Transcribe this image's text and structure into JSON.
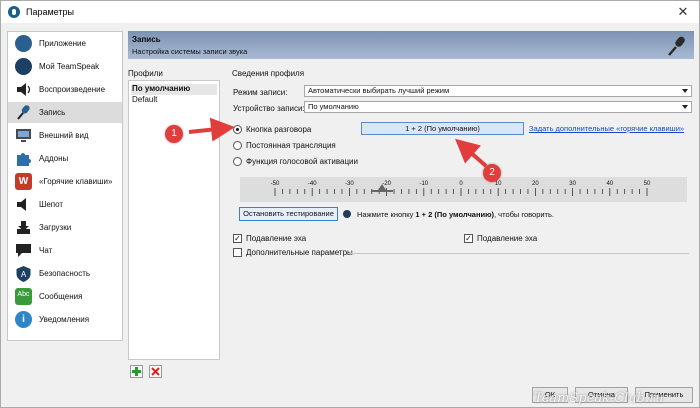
{
  "window": {
    "title": "Параметры"
  },
  "sidebar": {
    "items": [
      {
        "label": "Приложение",
        "icon": "teamspeak-app-icon",
        "color": "#2b5f8f"
      },
      {
        "label": "Мой TeamSpeak",
        "icon": "teamspeak-user-icon",
        "color": "#1d3f63"
      },
      {
        "label": "Воспроизведение",
        "icon": "speaker-icon",
        "color": "#222222"
      },
      {
        "label": "Запись",
        "icon": "microphone-icon",
        "color": "#2b5f8f"
      },
      {
        "label": "Внешний вид",
        "icon": "monitor-icon",
        "color": "#4a4a4a"
      },
      {
        "label": "Аддоны",
        "icon": "puzzle-icon",
        "color": "#2f6ea8"
      },
      {
        "label": "«Горячие клавиши»",
        "icon": "hotkeys-icon",
        "color": "#c43a2b"
      },
      {
        "label": "Шепот",
        "icon": "whisper-icon",
        "color": "#222222"
      },
      {
        "label": "Загрузки",
        "icon": "download-icon",
        "color": "#222222"
      },
      {
        "label": "Чат",
        "icon": "chat-icon",
        "color": "#222222"
      },
      {
        "label": "Безопасность",
        "icon": "shield-icon",
        "color": "#1d3f63"
      },
      {
        "label": "Сообщения",
        "icon": "abc-spellcheck-icon",
        "color": "#3a9a3a"
      },
      {
        "label": "Уведомления",
        "icon": "info-icon",
        "color": "#2e86c9"
      }
    ],
    "selected_index": 3
  },
  "header": {
    "title": "Запись",
    "subtitle": "Настройка системы записи звука"
  },
  "profiles": {
    "label": "Профили",
    "items": [
      "По умолчанию",
      "Default"
    ],
    "selected_index": 0
  },
  "details": {
    "label": "Сведения профиля",
    "mode_label": "Режим записи:",
    "mode_value": "Автоматически выбирать лучший режим",
    "device_label": "Устройство записи:",
    "device_value": "По умолчанию",
    "radio_ptt": "Кнопка разговора",
    "radio_continuous": "Постоянная трансляция",
    "radio_va": "Функция голосовой активации",
    "hotkey_button": "1 + 2 (По умолчанию)",
    "hotkey_link": "Задать дополнительные «горячие клавиши»",
    "scale_labels": [
      "-50",
      "-40",
      "-30",
      "-20",
      "-10",
      "0",
      "10",
      "20",
      "30",
      "40",
      "50"
    ],
    "stop_test_button": "Остановить тестирование",
    "hint_prefix": "Нажмите кнопку ",
    "hint_key": "1 + 2 (По умолчанию)",
    "hint_suffix": ", чтобы говорить.",
    "echo_reduction": "Подавление эха",
    "echo_cancellation": "Подавление эха",
    "advanced": "Дополнительные параметры"
  },
  "footer": {
    "ok": "ОК",
    "cancel": "Отмена",
    "apply": "Применить"
  },
  "annotations": {
    "badge1": "1",
    "badge2": "2",
    "arrow_color": "#e23d3d"
  },
  "watermark": "TeamSpeak-Club.ru"
}
